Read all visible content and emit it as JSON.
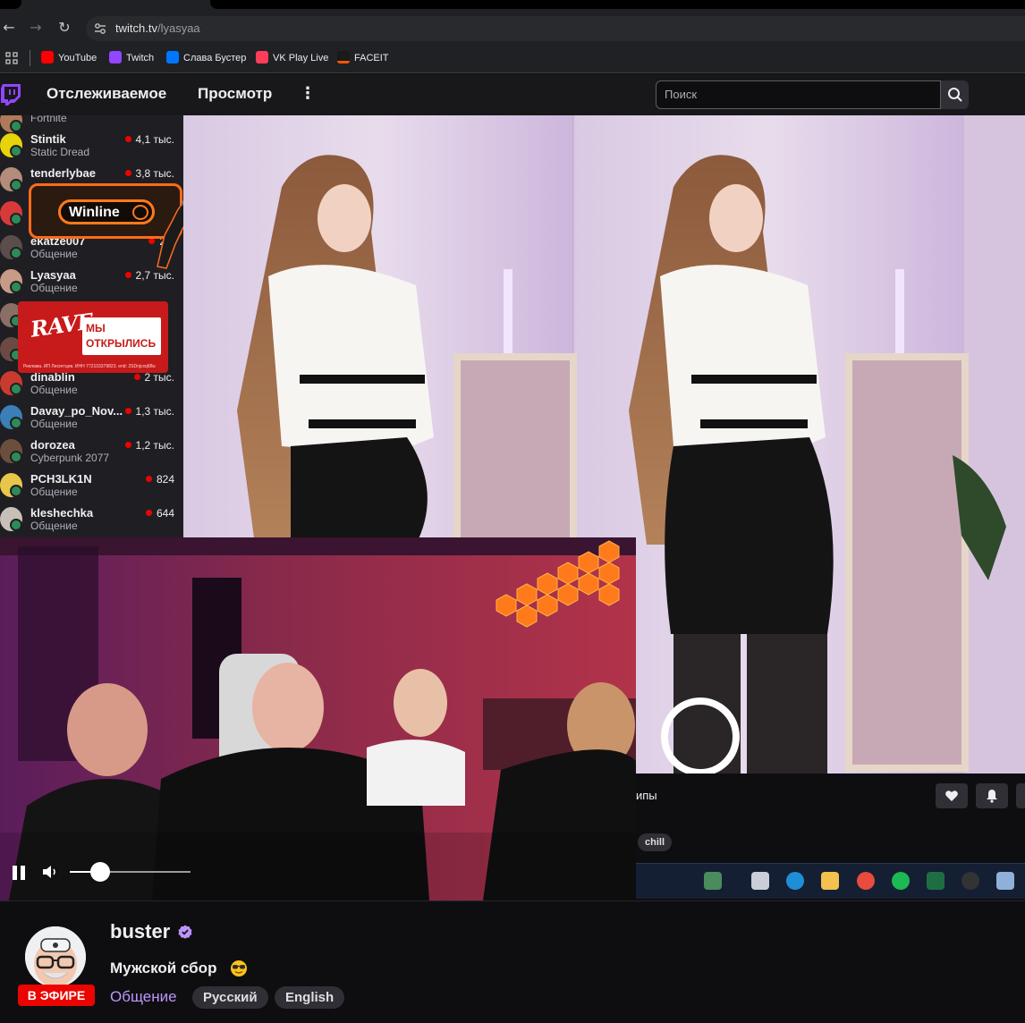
{
  "browser": {
    "url_host": "twitch.tv",
    "url_path": "/lyasyaa",
    "bookmarks": [
      {
        "label": "YouTube",
        "icon": "youtube-icon",
        "color": "#ff0000"
      },
      {
        "label": "Twitch",
        "icon": "twitch-icon",
        "color": "#9146ff"
      },
      {
        "label": "Слава Бустер",
        "icon": "vk-icon",
        "color": "#0077ff"
      },
      {
        "label": "VK Play Live",
        "icon": "vkplay-icon",
        "color": "#ff3d5a"
      },
      {
        "label": "FACEIT",
        "icon": "faceit-icon",
        "color": "#ff5500"
      }
    ]
  },
  "header": {
    "following": "Отслеживаемое",
    "browse": "Просмотр",
    "search_placeholder": "Поиск"
  },
  "sidebar": {
    "top_partial_category": "Fortnite",
    "channels": [
      {
        "name": "Stintik",
        "category": "Static Dread",
        "viewers": "4,1 тыс.",
        "avatar_color": "#e6d30a"
      },
      {
        "name": "tenderlybae",
        "category": "",
        "viewers": "3,8 тыс.",
        "avatar_color": "#b38d7a"
      },
      {
        "name": "",
        "category": "",
        "viewers": "",
        "avatar_color": "#d83a3a"
      },
      {
        "name": "ekatze007",
        "category": "Общение",
        "viewers": "2,7",
        "avatar_color": "#5b4d49"
      },
      {
        "name": "Lyasyaa",
        "category": "Общение",
        "viewers": "2,7 тыс.",
        "avatar_color": "#c89b86"
      },
      {
        "name": "",
        "category": "",
        "viewers": "",
        "avatar_color": "#8a6f66"
      },
      {
        "name": "",
        "category": "",
        "viewers": "",
        "avatar_color": "#6a4a43"
      },
      {
        "name": "dinablin",
        "category": "Общение",
        "viewers": "2 тыс.",
        "avatar_color": "#c93b2f"
      },
      {
        "name": "Davay_po_Nov...",
        "category": "Общение",
        "viewers": "1,3 тыс.",
        "avatar_color": "#3a7fb8"
      },
      {
        "name": "dorozea",
        "category": "Cyberpunk 2077",
        "viewers": "1,2 тыс.",
        "avatar_color": "#6b4f3d"
      },
      {
        "name": "PCH3LK1N",
        "category": "Общение",
        "viewers": "824",
        "avatar_color": "#e8c64a"
      },
      {
        "name": "kleshechka",
        "category": "Общение",
        "viewers": "644",
        "avatar_color": "#c8c0b8"
      }
    ],
    "ad_winline": "Winline",
    "ad_rave_logo": "RAVE",
    "ad_rave_headline": "МЫ ОТКРЫЛИСЬ",
    "ad_rave_fine": "Реклама. ИП Лесигтцев. ИНН 772103379823. erid: 2SDnjcxq6Bu"
  },
  "main_stream": {
    "clips_label": "ипы",
    "tag": "chill"
  },
  "player": {
    "volume": 0.25
  },
  "channel": {
    "name": "buster",
    "title": "Мужской сбор",
    "live_badge": "В ЭФИРЕ",
    "category": "Общение",
    "tags": [
      "Русский",
      "English"
    ]
  },
  "colors": {
    "twitch_purple": "#9146ff",
    "live_red": "#eb0400",
    "category_link": "#bf94ff"
  }
}
